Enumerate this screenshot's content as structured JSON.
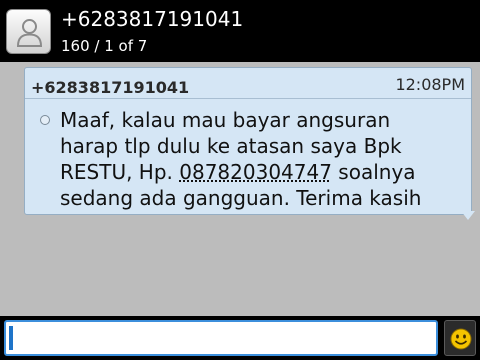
{
  "header": {
    "contact": "+6283817191041",
    "counter": "160 / 1 of 7",
    "avatar_icon": "contact-silhouette-icon"
  },
  "message": {
    "sender": "+6283817191041",
    "time": "12:08PM",
    "status_icon": "sent-status-dot-icon",
    "lines": [
      {
        "before": "Maaf, kalau mau bayar angsuran",
        "link": "",
        "after": ""
      },
      {
        "before": "harap tlp dulu ke atasan saya Bpk",
        "link": "",
        "after": ""
      },
      {
        "before": "RESTU, Hp. ",
        "link": "087820304747",
        "after": " soalnya"
      },
      {
        "before": "sedang ada gangguan. Terima kasih",
        "link": "",
        "after": ""
      }
    ]
  },
  "composer": {
    "value": "",
    "emoji_icon": "smiley-icon"
  },
  "colors": {
    "header_bg": "#000000",
    "conversation_bg": "#bcbcbc",
    "bubble_bg": "#d5e6f5",
    "compose_border": "#3c8fdc",
    "emoji_yellow": "#f4c400"
  }
}
